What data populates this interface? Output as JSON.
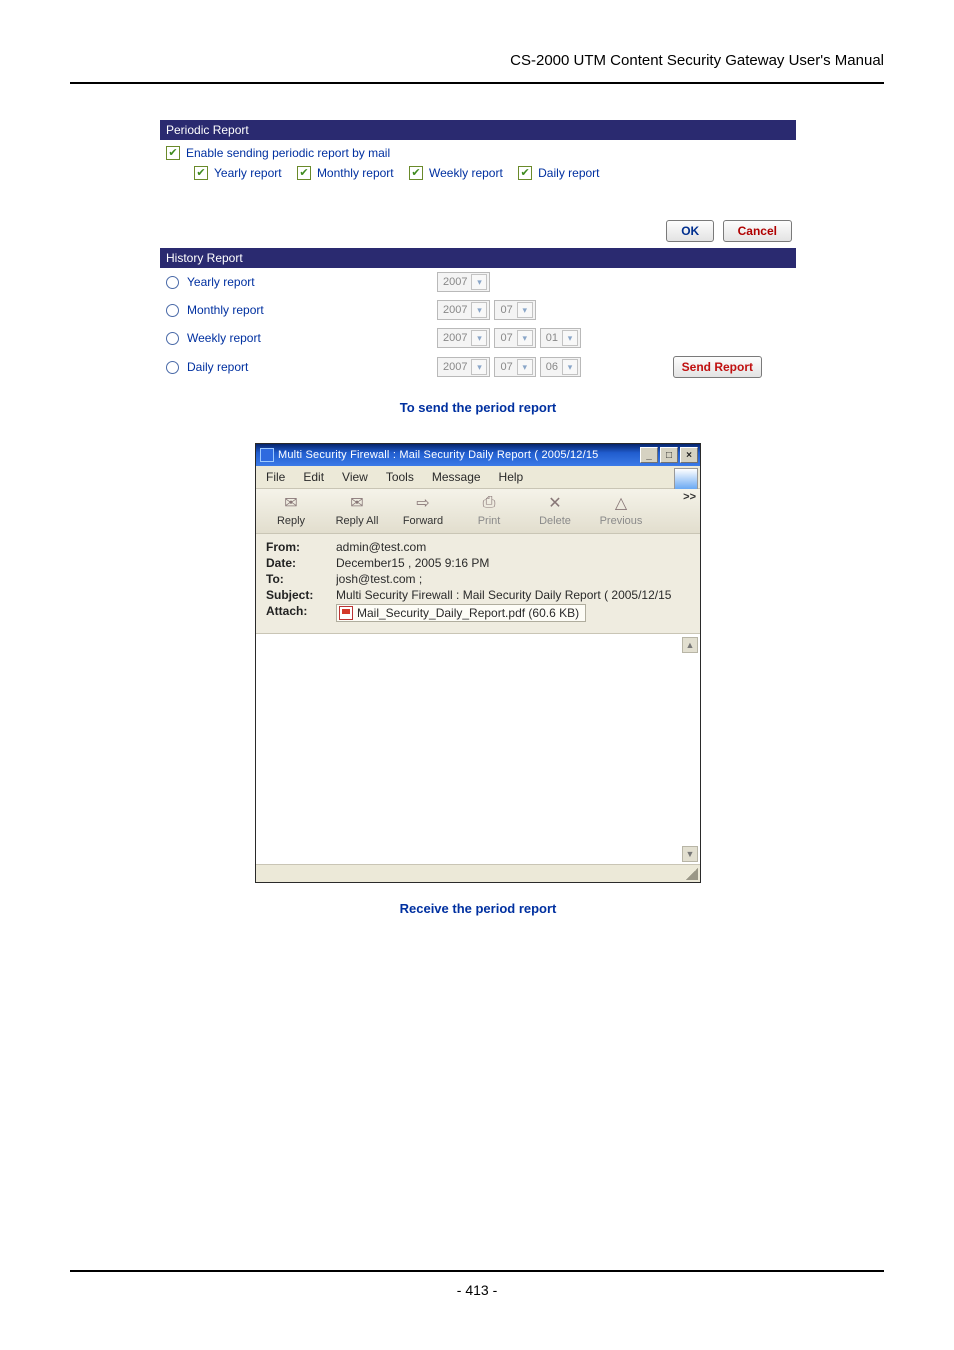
{
  "page": {
    "header": "CS-2000  UTM  Content  Security  Gateway  User's  Manual",
    "footer": "- 413 -"
  },
  "periodic": {
    "title": "Periodic Report",
    "enable_label": "Enable sending periodic report by mail",
    "yearly": "Yearly report",
    "monthly": "Monthly report",
    "weekly": "Weekly report",
    "daily": "Daily report",
    "check": "✔"
  },
  "buttons": {
    "ok": "OK",
    "cancel": "Cancel",
    "send_report": "Send Report"
  },
  "history": {
    "title": "History Report",
    "yearly": "Yearly report",
    "monthly": "Monthly report",
    "weekly": "Weekly report",
    "daily": "Daily report",
    "selects": {
      "y_year": "2007",
      "m_year": "2007",
      "m_month": "07",
      "w_year": "2007",
      "w_month": "07",
      "w_week": "01",
      "d_year": "2007",
      "d_month": "07",
      "d_day": "06"
    }
  },
  "captions": {
    "send": "To send the period report",
    "receive": "Receive the period report"
  },
  "oe": {
    "title": "Multi Security Firewall : Mail Security Daily Report ( 2005/12/15",
    "menu": {
      "file": "File",
      "edit": "Edit",
      "view": "View",
      "tools": "Tools",
      "message": "Message",
      "help": "Help"
    },
    "toolbar": {
      "reply": "Reply",
      "reply_all": "Reply All",
      "forward": "Forward",
      "print": "Print",
      "delete": "Delete",
      "previous": "Previous",
      "expand": ">>"
    },
    "headers": {
      "from_l": "From:",
      "from_v": "admin@test.com",
      "date_l": "Date:",
      "date_v": "December15 , 2005 9:16 PM",
      "to_l": "To:",
      "to_v": "josh@test.com ;",
      "subj_l": "Subject:",
      "subj_v": "Multi Security Firewall : Mail Security Daily Report ( 2005/12/15",
      "att_l": "Attach:",
      "att_v": "Mail_Security_Daily_Report.pdf (60.6 KB)"
    },
    "winbtns": {
      "min": "_",
      "max": "□",
      "close": "×"
    }
  }
}
